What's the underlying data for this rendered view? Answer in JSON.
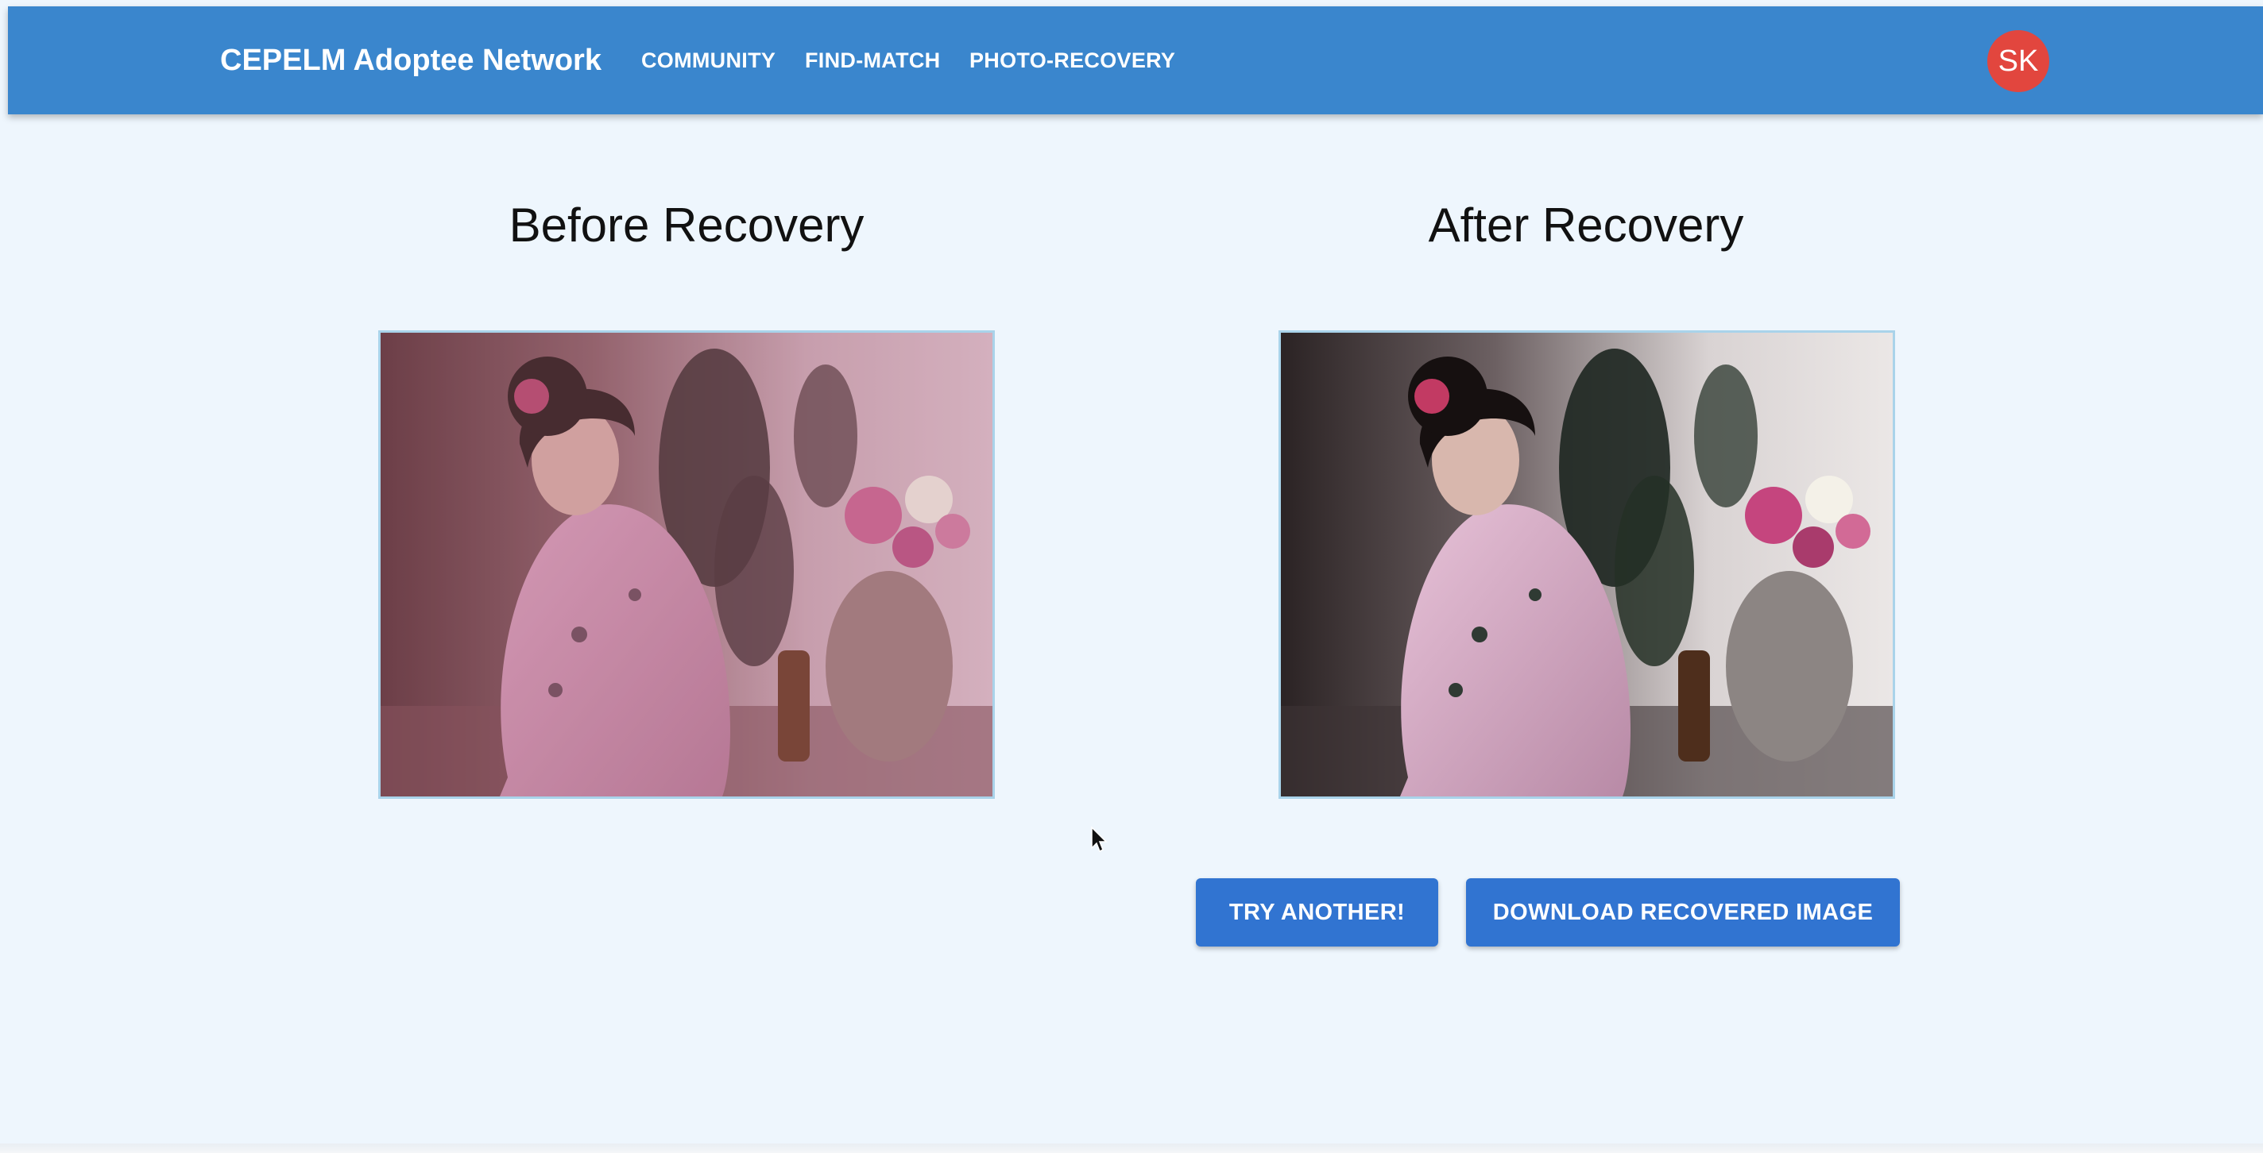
{
  "appbar": {
    "brand": "CEPELM Adoptee Network",
    "nav": [
      "COMMUNITY",
      "FIND-MATCH",
      "PHOTO-RECOVERY"
    ],
    "avatar_initials": "SK",
    "color": "#3a86cd",
    "avatar_color": "#e2463e"
  },
  "comparison": {
    "before_title": "Before Recovery",
    "after_title": "After Recovery",
    "before_image_icon": "faded-portrait-photo",
    "after_image_icon": "restored-portrait-photo"
  },
  "actions": {
    "try_another_label": "TRY ANOTHER!",
    "download_label": "DOWNLOAD RECOVERED IMAGE",
    "button_color": "#3174d1"
  },
  "colors": {
    "page_background": "#eef6fd",
    "photo_border": "#a9d3ea"
  }
}
